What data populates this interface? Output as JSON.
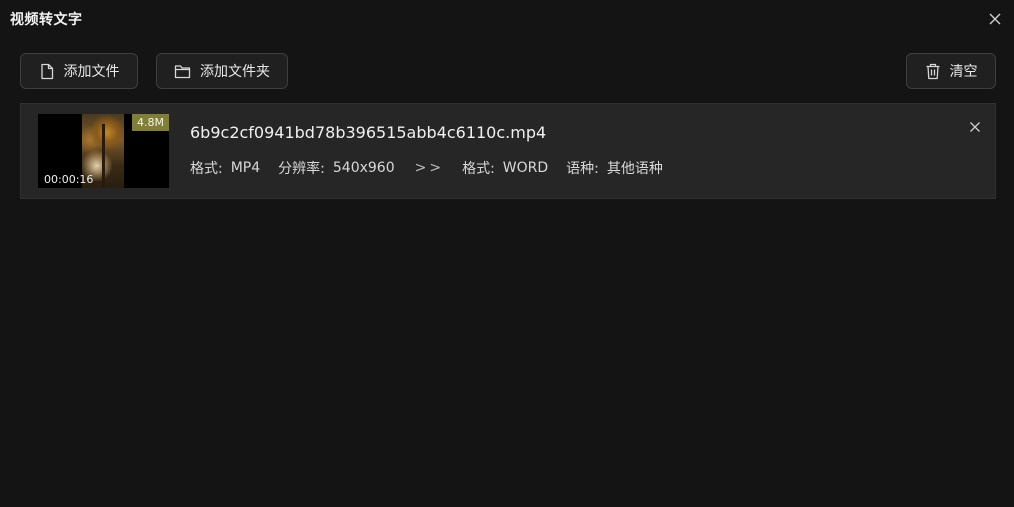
{
  "window": {
    "title": "视频转文字"
  },
  "toolbar": {
    "add_file_label": "添加文件",
    "add_folder_label": "添加文件夹",
    "clear_label": "清空"
  },
  "files": [
    {
      "name": "6b9c2cf0941bd78b396515abb4c6110c.mp4",
      "size": "4.8M",
      "duration": "00:00:16",
      "format_label": "格式:",
      "format": "MP4",
      "resolution_label": "分辨率:",
      "resolution": "540x960",
      "arrow": ">>",
      "output_format_label": "格式:",
      "output_format": "WORD",
      "language_label": "语种:",
      "language": "其他语种"
    }
  ],
  "icons": {
    "close": "close-icon",
    "file": "file-icon",
    "folder": "folder-icon",
    "trash": "trash-icon"
  },
  "colors": {
    "background": "#141414",
    "card": "#262626",
    "button": "#202020",
    "badge": "#807e37",
    "text": "#e6e6e6"
  }
}
